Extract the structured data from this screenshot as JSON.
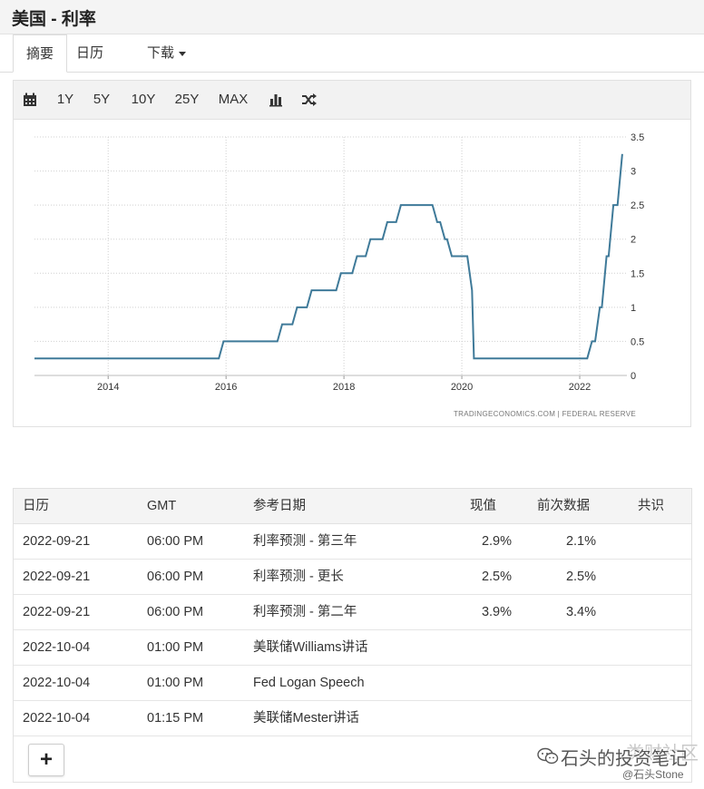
{
  "page": {
    "title": "美国 - 利率"
  },
  "tabs": [
    {
      "label": "摘要",
      "active": true
    },
    {
      "label": "日历",
      "active": false
    },
    {
      "label": "下载",
      "active": false
    }
  ],
  "toolbar": {
    "calendar_icon": "calendar-icon",
    "ranges": [
      "1Y",
      "5Y",
      "10Y",
      "25Y",
      "MAX"
    ],
    "bar_icon": "bar-chart-icon",
    "shuffle_icon": "shuffle-icon"
  },
  "chart_data": {
    "type": "line",
    "color": "#3f7a99",
    "x_ticks": [
      "2014",
      "2016",
      "2018",
      "2020",
      "2022"
    ],
    "y_ticks": [
      "0",
      "0.5",
      "1",
      "1.5",
      "2",
      "2.5",
      "3",
      "3.5"
    ],
    "ylim": [
      0,
      3.5
    ],
    "xlim": [
      2012.75,
      2022.8
    ],
    "grid": true,
    "y_axis_side": "right",
    "source": "TRADINGECONOMICS.COM | FEDERAL RESERVE",
    "series": [
      {
        "x": [
          "2012-10",
          "2015-12-16",
          "2016-12-14",
          "2017-03-15",
          "2017-06-14",
          "2017-12-13",
          "2018-03-21",
          "2018-06-13",
          "2018-09-26",
          "2018-12-19",
          "2019-07-31",
          "2019-09-18",
          "2019-10-30",
          "2020-03-03",
          "2020-03-15",
          "2022-03-16",
          "2022-05-04",
          "2022-06-15",
          "2022-07-27",
          "2022-09-21"
        ],
        "values": [
          0.25,
          0.5,
          0.75,
          1.0,
          1.25,
          1.5,
          1.75,
          2.0,
          2.25,
          2.5,
          2.25,
          2.0,
          1.75,
          1.25,
          0.25,
          0.5,
          1.0,
          1.75,
          2.5,
          3.25
        ]
      }
    ]
  },
  "table": {
    "headers": [
      "日历",
      "GMT",
      "参考日期",
      "现值",
      "前次数据",
      "共识"
    ],
    "rows": [
      {
        "date": "2022-09-21",
        "time": "06:00 PM",
        "event": "利率预测 - 第三年",
        "actual": "2.9%",
        "previous": "2.1%",
        "consensus": ""
      },
      {
        "date": "2022-09-21",
        "time": "06:00 PM",
        "event": "利率预测 - 更长",
        "actual": "2.5%",
        "previous": "2.5%",
        "consensus": ""
      },
      {
        "date": "2022-09-21",
        "time": "06:00 PM",
        "event": "利率预测 - 第二年",
        "actual": "3.9%",
        "previous": "3.4%",
        "consensus": ""
      },
      {
        "date": "2022-10-04",
        "time": "01:00 PM",
        "event": "美联储Williams讲话",
        "actual": "",
        "previous": "",
        "consensus": ""
      },
      {
        "date": "2022-10-04",
        "time": "01:00 PM",
        "event": "Fed Logan Speech",
        "actual": "",
        "previous": "",
        "consensus": ""
      },
      {
        "date": "2022-10-04",
        "time": "01:15 PM",
        "event": "美联储Mester讲话",
        "actual": "",
        "previous": "",
        "consensus": ""
      }
    ],
    "add_label": "+"
  },
  "watermark": {
    "text": "石头的投资笔记",
    "handle": "@石头Stone",
    "faded": "类财社区",
    "icon": "wechat-icon"
  }
}
